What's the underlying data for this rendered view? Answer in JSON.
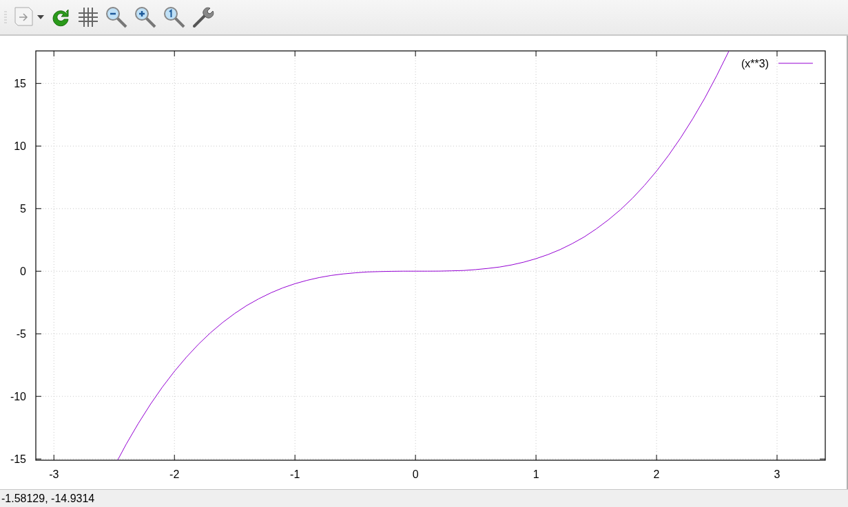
{
  "plot": {
    "chart_data": {
      "type": "line",
      "grid": true,
      "xlim": [
        -3.15,
        3.4
      ],
      "ylim": [
        -15.1,
        17.6
      ],
      "xticks": [
        -3,
        -2,
        -1,
        0,
        1,
        2,
        3
      ],
      "yticks": [
        -15,
        -10,
        -5,
        0,
        5,
        10,
        15
      ],
      "x": [
        -2.47,
        -2.4,
        -2.3,
        -2.2,
        -2.1,
        -2.0,
        -1.9,
        -1.8,
        -1.7,
        -1.6,
        -1.5,
        -1.4,
        -1.3,
        -1.2,
        -1.1,
        -1.0,
        -0.9,
        -0.8,
        -0.7,
        -0.6,
        -0.5,
        -0.4,
        -0.3,
        -0.2,
        -0.1,
        0,
        0.1,
        0.2,
        0.3,
        0.4,
        0.5,
        0.6,
        0.7,
        0.8,
        0.9,
        1.0,
        1.1,
        1.2,
        1.3,
        1.4,
        1.5,
        1.6,
        1.7,
        1.8,
        1.9,
        2.0,
        2.1,
        2.2,
        2.3,
        2.4,
        2.5,
        2.6
      ],
      "series": [
        {
          "name": "(x**3)",
          "color": "#9400d3",
          "values": [
            -15.07,
            -13.82,
            -12.17,
            -10.65,
            -9.26,
            -8,
            -6.86,
            -5.83,
            -4.91,
            -4.1,
            -3.38,
            -2.74,
            -2.2,
            -1.73,
            -1.33,
            -1,
            -0.73,
            -0.51,
            -0.34,
            -0.22,
            -0.13,
            -0.06,
            -0.03,
            -0.01,
            0,
            0,
            0,
            0.01,
            0.03,
            0.06,
            0.13,
            0.22,
            0.34,
            0.51,
            0.73,
            1,
            1.33,
            1.73,
            2.2,
            2.74,
            3.38,
            4.1,
            4.91,
            5.83,
            6.86,
            8,
            9.26,
            10.65,
            12.17,
            13.82,
            15.63,
            17.58
          ]
        }
      ]
    }
  },
  "status_bar": {
    "text": "-1.58129, -14.9314"
  }
}
